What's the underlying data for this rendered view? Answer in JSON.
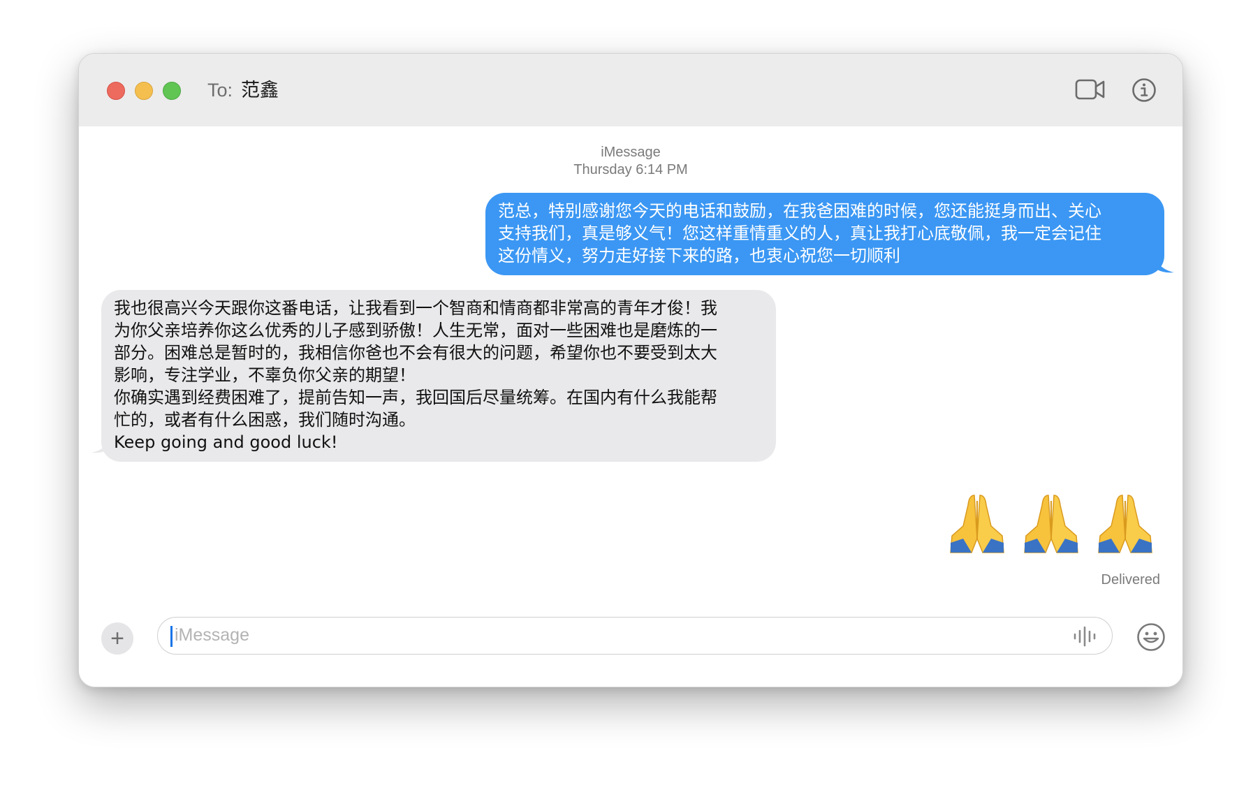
{
  "window": {
    "to_label": "To:",
    "recipient": "范鑫",
    "icons": {
      "video": "video-camera-icon",
      "info": "info-icon"
    }
  },
  "conversation": {
    "service": "iMessage",
    "timestamp": "Thursday 6:14 PM",
    "messages": [
      {
        "direction": "sent",
        "lines": [
          "范总，特别感谢您今天的电话和鼓励，在我爸困难的时候，您还能挺身而出、关心",
          "支持我们，真是够义气！您这样重情重义的人，真让我打心底敬佩，我一定会记住",
          "这份情义，努力走好接下来的路，也衷心祝您一切顺利"
        ]
      },
      {
        "direction": "received",
        "lines": [
          "我也很高兴今天跟你这番电话，让我看到一个智商和情商都非常高的青年才俊！我",
          "为你父亲培养你这么优秀的儿子感到骄傲！人生无常，面对一些困难也是磨炼的一",
          "部分。困难总是暂时的，我相信你爸也不会有很大的问题，希望你也不要受到太大",
          "影响，专注学业，不辜负你父亲的期望！",
          "你确实遇到经费困难了，提前告知一声，我回国后尽量统筹。在国内有什么我能帮",
          "忙的，或者有什么困惑，我们随时沟通。",
          "Keep going and good luck!"
        ]
      },
      {
        "direction": "sent",
        "emoji": [
          "folded-hands-emoji",
          "folded-hands-emoji",
          "folded-hands-emoji"
        ]
      }
    ],
    "status": "Delivered"
  },
  "composer": {
    "placeholder": "iMessage",
    "icons": {
      "add": "plus-icon",
      "audio": "audio-waveform-icon",
      "emoji": "smiley-icon"
    }
  },
  "colors": {
    "sent_bubble": "#3b97f3",
    "received_bubble": "#e9e9eb",
    "titlebar": "#ececec"
  }
}
